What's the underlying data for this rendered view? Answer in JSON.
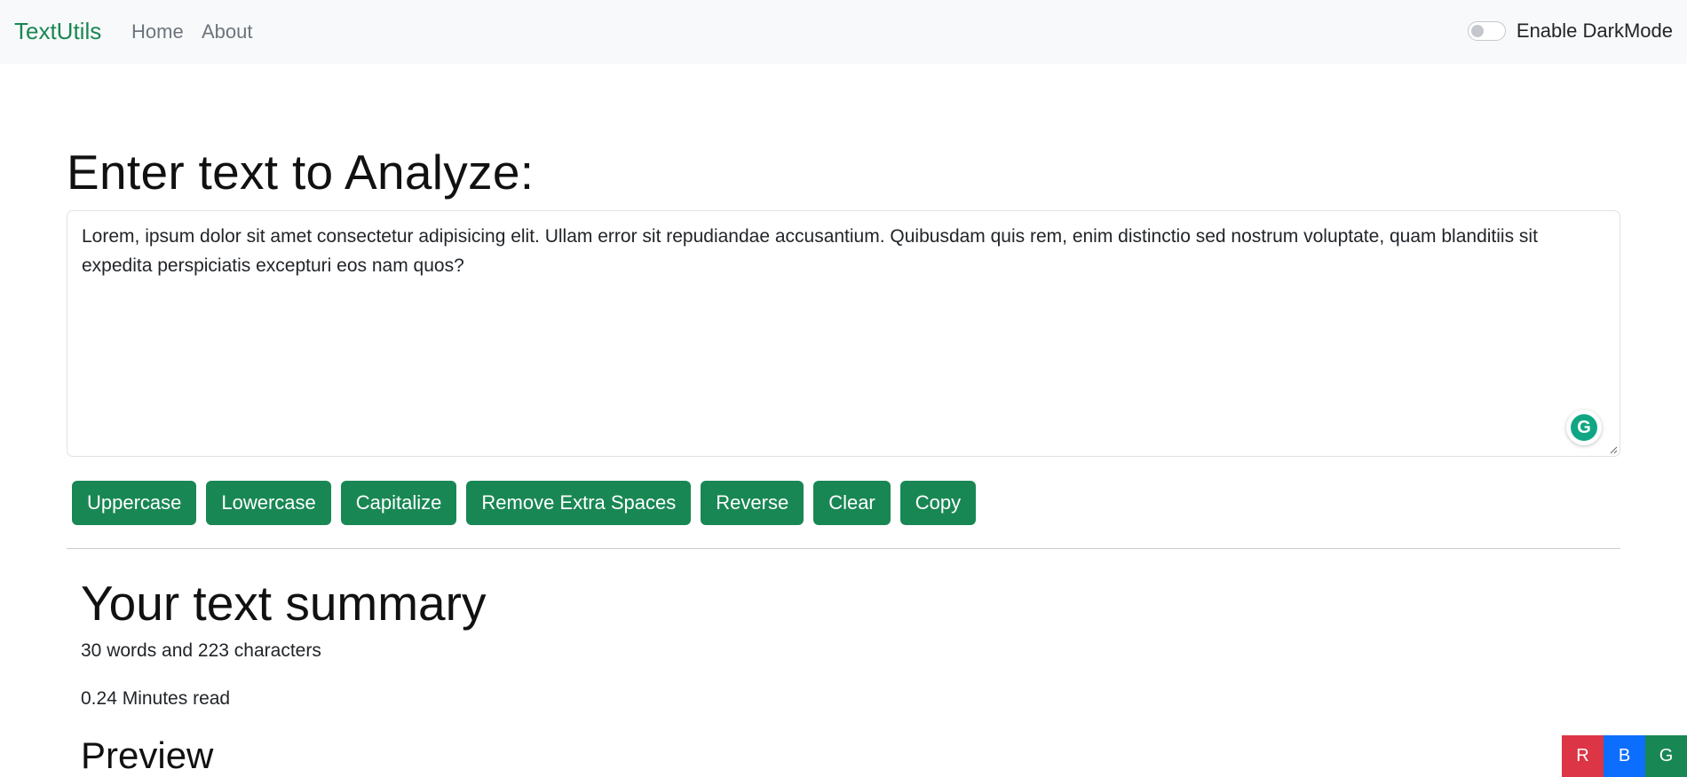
{
  "navbar": {
    "brand": "TextUtils",
    "links": [
      {
        "label": "Home"
      },
      {
        "label": "About"
      }
    ],
    "darkmode_label": "Enable DarkMode"
  },
  "main": {
    "heading": "Enter text to Analyze:",
    "textarea_value": "Lorem, ipsum dolor sit amet consectetur adipisicing elit. Ullam error sit repudiandae accusantium. Quibusdam quis rem, enim distinctio sed nostrum voluptate, quam blanditiis sit expedita perspiciatis excepturi eos nam quos?",
    "buttons": [
      {
        "label": "Uppercase"
      },
      {
        "label": "Lowercase"
      },
      {
        "label": "Capitalize"
      },
      {
        "label": "Remove Extra Spaces"
      },
      {
        "label": "Reverse"
      },
      {
        "label": "Clear"
      },
      {
        "label": "Copy"
      }
    ]
  },
  "summary": {
    "heading": "Your text summary",
    "words_line": "30 words and 223 characters",
    "read_line": "0.24 Minutes read",
    "preview_heading": "Preview"
  },
  "theme_buttons": [
    {
      "label": "R",
      "color": "#dc3545"
    },
    {
      "label": "B",
      "color": "#0d6efd"
    },
    {
      "label": "G",
      "color": "#198754"
    }
  ],
  "colors": {
    "accent": "#198754",
    "navbar_bg": "#f8f9fa"
  }
}
